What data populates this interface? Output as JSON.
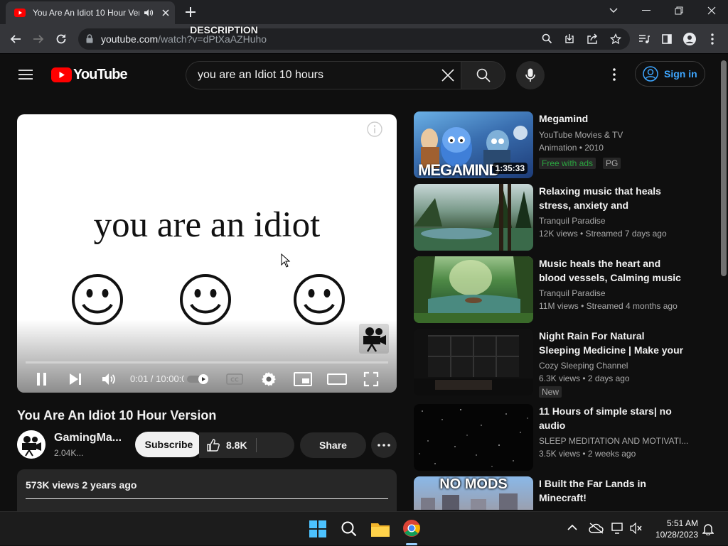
{
  "browser": {
    "tab_title": "You Are An Idiot 10 Hour Ver",
    "url_host": "youtube.com",
    "url_path": "/watch?v=dPtXaAZHuho"
  },
  "header": {
    "logo_text": "YouTube",
    "search_query": "you are an Idiot 10 hours",
    "signin_label": "Sign in"
  },
  "player": {
    "frame_text": "you are an idiot",
    "time_display": "0:01 / 10:00:00",
    "progress": 0.0
  },
  "video": {
    "title": "You Are An Idiot 10 Hour Version",
    "channel_name": "GamingMa...",
    "channel_subs": "2.04K...",
    "subscribe_label": "Subscribe",
    "like_count": "8.8K",
    "share_label": "Share",
    "desc_meta": "573K views  2 years ago",
    "desc_label": "DESCRIPTION"
  },
  "recommendations": [
    {
      "title": "Megamind",
      "channel": "YouTube Movies & TV",
      "meta": "Animation • 2010",
      "badge1": "Free with ads",
      "badge2": "PG",
      "duration": "1:35:33",
      "thumb_text": "MEGAMIND"
    },
    {
      "title": "Relaxing music that heals stress, anxiety and depressive…",
      "channel": "Tranquil Paradise",
      "meta": "12K views  • Streamed 7 days ago"
    },
    {
      "title": "Music heals the heart and blood vessels, Calming music restor…",
      "channel": "Tranquil Paradise",
      "meta": "11M views  • Streamed 4 months ago"
    },
    {
      "title": "Night Rain For Natural Sleeping Medicine | Make your Day Mor…",
      "channel": "Cozy Sleeping Channel",
      "meta": "6.3K views  • 2 days ago",
      "badge1": "New"
    },
    {
      "title": "11 Hours of simple stars| no audio",
      "channel": "SLEEP MEDITATION AND MOTIVATI...",
      "meta": "3.5K views  • 2 weeks ago"
    },
    {
      "title": "I Built the Far Lands in Minecraft!",
      "thumb_text": "NO MODS"
    }
  ],
  "taskbar": {
    "time": "5:51 AM",
    "date": "10/28/2023"
  },
  "colors": {
    "yt_red": "#ff0000",
    "bg": "#0f0f0f",
    "link_blue": "#3ea6ff",
    "free_green": "#2ba640"
  }
}
